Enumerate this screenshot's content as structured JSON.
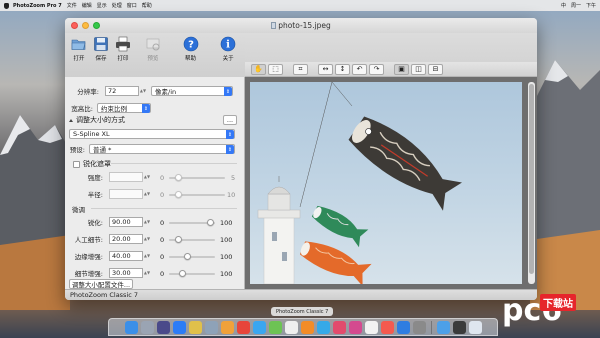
{
  "menubar": {
    "app": "PhotoZoom Pro 7",
    "items": [
      "文件",
      "编辑",
      "显示",
      "处理",
      "窗口",
      "帮助"
    ],
    "right_items": [
      "中",
      "周一",
      "下午"
    ]
  },
  "window": {
    "title": "photo-15.jpeg",
    "status": "PhotoZoom Classic 7"
  },
  "toolbar": {
    "buttons": [
      {
        "label": "打开",
        "icon": "folder-open-icon",
        "enabled": true
      },
      {
        "label": "保存",
        "icon": "floppy-save-icon",
        "enabled": true
      },
      {
        "label": "打印",
        "icon": "printer-icon",
        "enabled": true
      },
      {
        "label": "预览",
        "icon": "preview-icon",
        "enabled": false
      },
      {
        "label": "帮助",
        "icon": "help-icon",
        "enabled": true
      },
      {
        "label": "关于",
        "icon": "info-icon",
        "enabled": true
      }
    ]
  },
  "tools": {
    "items": [
      "hand-tool-icon",
      "zoom-select-icon",
      "crop-icon",
      "horizontal-arrows-icon",
      "vertical-arrows-icon",
      "rotate-left-icon",
      "rotate-right-icon",
      "single-view-icon",
      "split-vertical-view-icon",
      "split-horizontal-view-icon"
    ]
  },
  "panel": {
    "resolution_label": "分辨率:",
    "resolution_value": "72",
    "resolution_unit": "像素/in",
    "aspect_label": "宽高比:",
    "aspect_value": "约束比例",
    "resize_method_label": "调整大小的方式",
    "more_button": "...",
    "method_value": "S-Spline XL",
    "preset_label": "预设:",
    "preset_value": "普通 *",
    "sharpen_mask_label": "锐化遮罩",
    "strength_label": "强度:",
    "strength_min": "0",
    "strength_max": "5",
    "radius_label": "半径:",
    "radius_min": "0",
    "radius_max": "10",
    "fine_tune_label": "微调",
    "sliders": [
      {
        "label": "锐化:",
        "value": "90.00",
        "min": "0",
        "max": "100",
        "level": 0.9
      },
      {
        "label": "人工细节:",
        "value": "20.00",
        "min": "0",
        "max": "100",
        "level": 0.2
      },
      {
        "label": "边缘增强:",
        "value": "40.00",
        "min": "0",
        "max": "100",
        "level": 0.4
      },
      {
        "label": "细节增强:",
        "value": "30.00",
        "min": "0",
        "max": "100",
        "level": 0.3
      }
    ],
    "profile_button": "调整大小配置文件..."
  },
  "dock": {
    "tooltip": "PhotoZoom Classic 7",
    "icon_colors": [
      "#3b8fe8",
      "#9aa4b3",
      "#4a4a8a",
      "#2c7cf6",
      "#e0c04a",
      "#8ea2b8",
      "#f0a13a",
      "#e7453b",
      "#3aa6f0",
      "#6dc354",
      "#efefef",
      "#f28c28",
      "#35a9e8",
      "#e24b6d",
      "#d44a8f",
      "#f2f2f2",
      "#f45a4f",
      "#2f7de1",
      "#8a8a8a",
      "#4da0e8",
      "#3b3b3b",
      "#dfe6ef"
    ]
  },
  "watermark": {
    "brand": "pc6",
    "tag": "下载站"
  }
}
